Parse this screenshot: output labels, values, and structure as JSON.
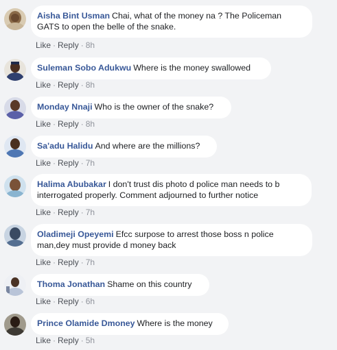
{
  "comments": [
    {
      "author": "Aisha Bint Usman",
      "text": "Chai, what of the money na ? The Policeman GATS to open the belle of the snake.",
      "like": "Like",
      "reply": "Reply",
      "time": "8h",
      "avatar_color": "#c9b79a"
    },
    {
      "author": "Suleman Sobo Adukwu",
      "text": "Where is the money swallowed",
      "like": "Like",
      "reply": "Reply",
      "time": "8h",
      "avatar_color": "#3b4a7a"
    },
    {
      "author": "Monday Nnaji",
      "text": "Who is the owner of the snake?",
      "like": "Like",
      "reply": "Reply",
      "time": "8h",
      "avatar_color": "#6a6fb0"
    },
    {
      "author": "Sa'adu Halidu",
      "text": "And where are the millions?",
      "like": "Like",
      "reply": "Reply",
      "time": "7h",
      "avatar_color": "#5b7fb5"
    },
    {
      "author": "Halima Abubakar",
      "text": "I don't trust dis photo d police man needs to b interrogated properly. Comment adjourned to further notice",
      "like": "Like",
      "reply": "Reply",
      "time": "7h",
      "avatar_color": "#7da9c9"
    },
    {
      "author": "Oladimeji Opeyemi",
      "text": "Efcc surpose to arrest those boss n police man,dey must provide d money back",
      "like": "Like",
      "reply": "Reply",
      "time": "7h",
      "avatar_color": "#4f6d8f"
    },
    {
      "author": "Thoma Jonathan",
      "text": "Shame on this country",
      "like": "Like",
      "reply": "Reply",
      "time": "6h",
      "avatar_color": "#b9c4d8"
    },
    {
      "author": "Prince Olamide Dmoney",
      "text": "Where is the money",
      "like": "Like",
      "reply": "Reply",
      "time": "5h",
      "avatar_color": "#3e3a34"
    }
  ],
  "colors": {
    "background": "#f2f3f5",
    "name": "#385898",
    "link": "#4b4f56",
    "meta": "#90949c"
  }
}
